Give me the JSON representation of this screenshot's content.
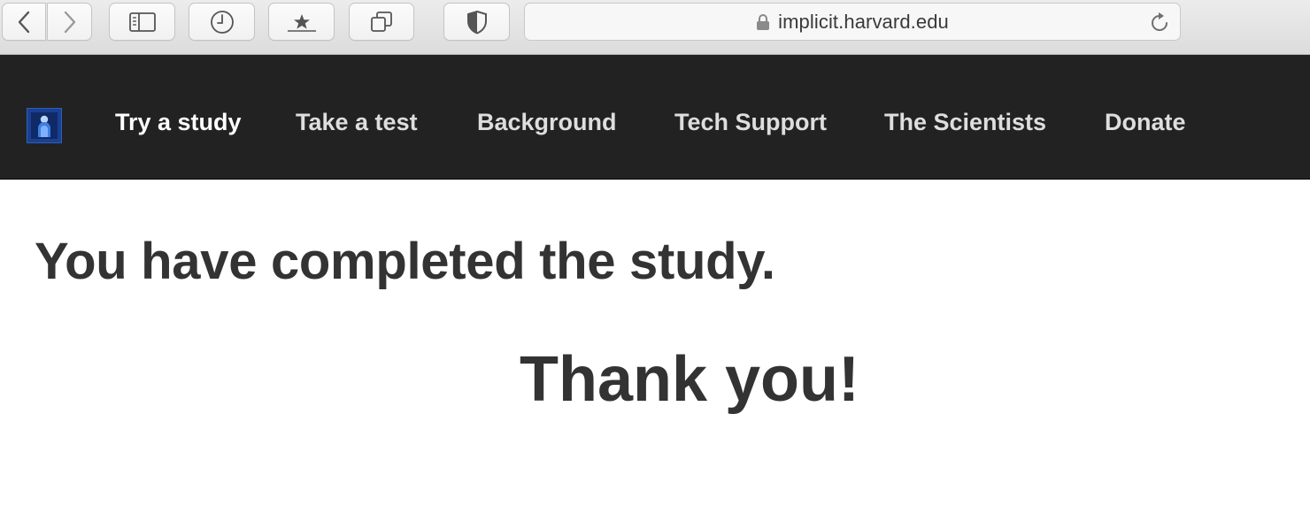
{
  "browser": {
    "url": "implicit.harvard.edu",
    "icons": {
      "back": "chevron-left-icon",
      "forward": "chevron-right-icon",
      "sidebar": "sidebar-icon",
      "history": "clock-icon",
      "bookmarks": "star-icon",
      "tabs": "tab-overview-icon",
      "privacy": "shield-icon",
      "lock": "lock-icon",
      "reload": "reload-icon"
    }
  },
  "navbar": {
    "background": "#222222",
    "items": [
      {
        "label": "Try a study"
      },
      {
        "label": "Take a test"
      },
      {
        "label": "Background"
      },
      {
        "label": "Tech Support"
      },
      {
        "label": "The Scientists"
      },
      {
        "label": "Donate"
      }
    ]
  },
  "main": {
    "heading": "You have completed the study.",
    "thanks": "Thank you!"
  }
}
